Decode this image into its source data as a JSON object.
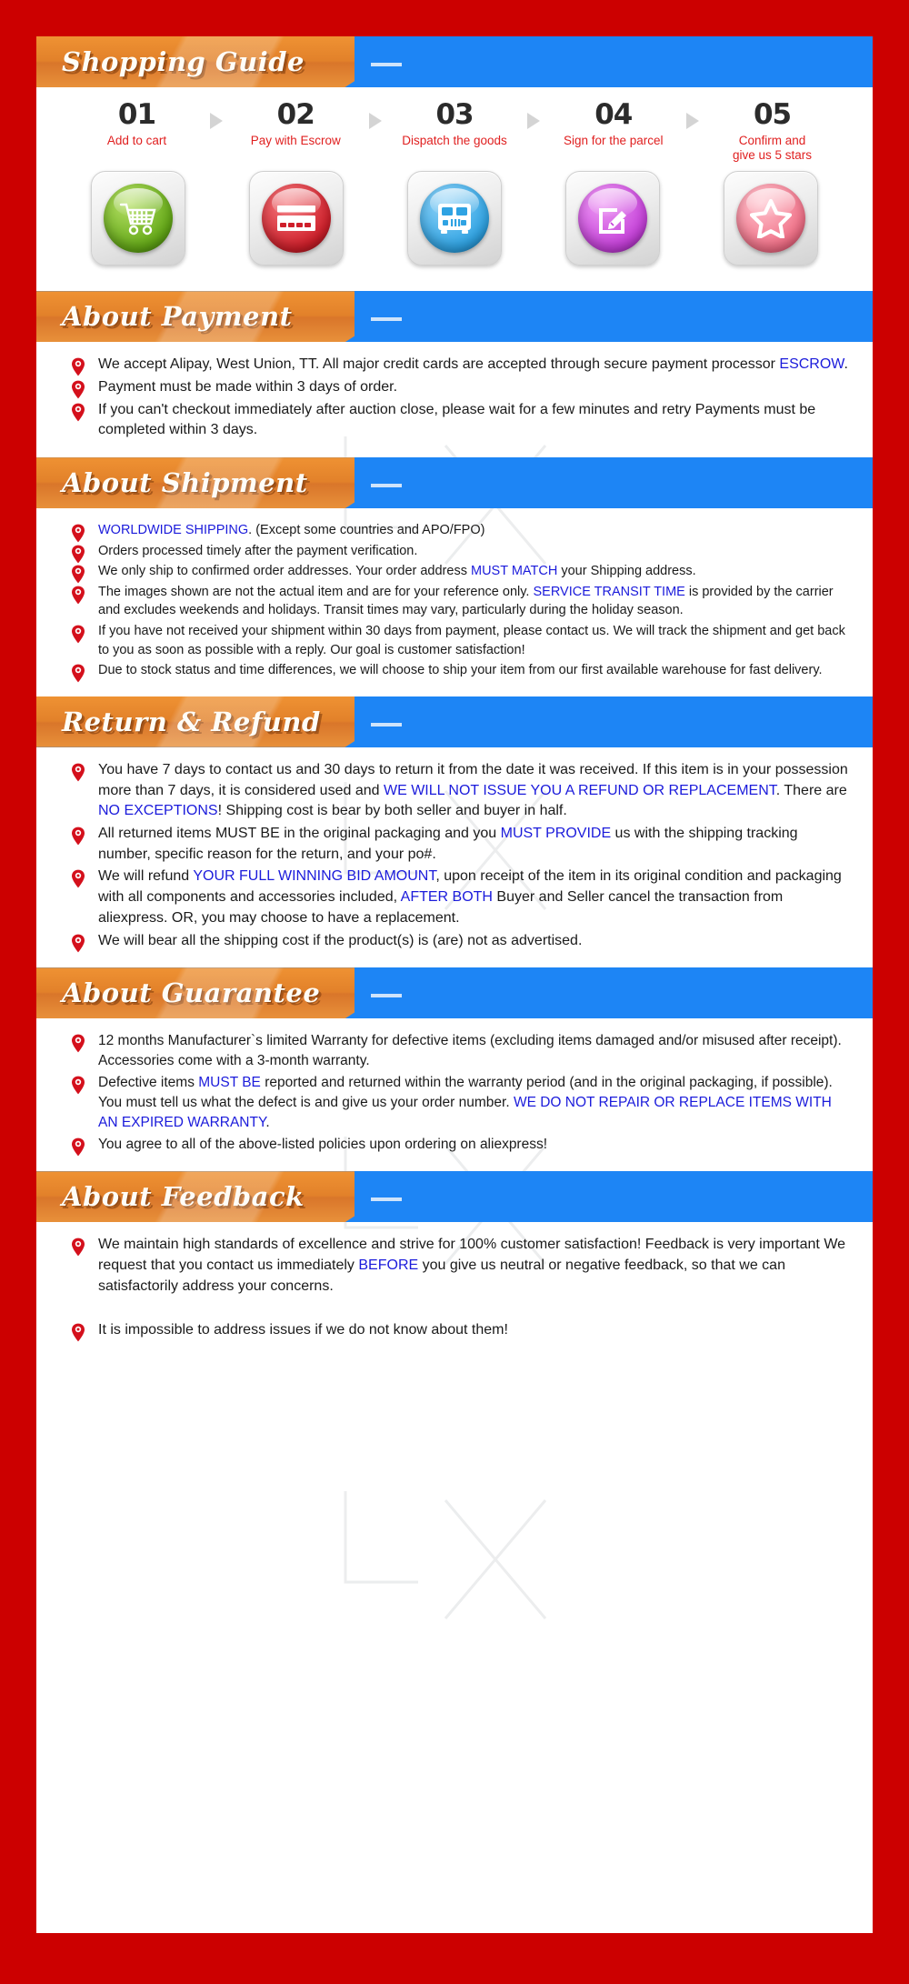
{
  "theme": {
    "page_background": "#cc0000",
    "banner_orange": "#e2812a",
    "banner_blue": "#1d85f5",
    "highlight_blue": "#1b1bdb",
    "step_label_red": "#e02020"
  },
  "guide": {
    "title": "Shopping Guide",
    "steps": [
      {
        "num": "01",
        "label": "Add to cart",
        "icon": "shopping-cart-icon",
        "color": "#63a816"
      },
      {
        "num": "02",
        "label": "Pay with Escrow",
        "icon": "credit-card-icon",
        "color": "#cf1f2a"
      },
      {
        "num": "03",
        "label": "Dispatch the goods",
        "icon": "delivery-truck-icon",
        "color": "#2fa3e3"
      },
      {
        "num": "04",
        "label": "Sign for the parcel",
        "icon": "sign-document-icon",
        "color": "#c43fd8"
      },
      {
        "num": "05",
        "label": "Confirm and\ngive us 5 stars",
        "icon": "star-rating-icon",
        "color": "#f06f86"
      }
    ]
  },
  "sections": [
    {
      "title": "About Payment",
      "items": [
        [
          {
            "t": "We accept Alipay, West Union, TT. All major credit cards are accepted through secure payment processor "
          },
          {
            "t": "ESCROW",
            "hl": true
          },
          {
            "t": "."
          }
        ],
        [
          {
            "t": "Payment must be made within 3 days of order."
          }
        ],
        [
          {
            "t": "If you can't checkout immediately after auction close, please wait for a few minutes and retry Payments must be completed within 3 days."
          }
        ]
      ]
    },
    {
      "title": "About Shipment",
      "items": [
        [
          {
            "t": "WORLDWIDE SHIPPING",
            "hl": true
          },
          {
            "t": ". (Except some countries and APO/FPO)"
          }
        ],
        [
          {
            "t": "Orders processed timely after the payment verification."
          }
        ],
        [
          {
            "t": "We only ship to confirmed order addresses. Your order address "
          },
          {
            "t": "MUST MATCH",
            "hl": true
          },
          {
            "t": " your Shipping address."
          }
        ],
        [
          {
            "t": "The images shown are not the actual item and are for your reference only. "
          },
          {
            "t": "SERVICE TRANSIT TIME",
            "hl": true
          },
          {
            "t": " is provided by the carrier and excludes weekends and holidays. Transit times may vary, particularly during the holiday season."
          }
        ],
        [
          {
            "t": "If you have not received your shipment within 30 days from payment, please contact us. We will track the shipment and get back to you as soon as possible with a reply. Our goal is customer satisfaction!"
          }
        ],
        [
          {
            "t": "Due to stock status and time differences, we will choose to ship your item from our first available warehouse for fast delivery."
          }
        ]
      ]
    },
    {
      "title": "Return & Refund",
      "items": [
        [
          {
            "t": "You have 7 days to contact us and 30 days to return it from the date it was received. If this item is in your possession more than 7 days, it is considered used and "
          },
          {
            "t": "WE WILL NOT ISSUE YOU A REFUND OR REPLACEMENT",
            "hl": true
          },
          {
            "t": ". There are "
          },
          {
            "t": "NO EXCEPTIONS",
            "hl": true
          },
          {
            "t": "! Shipping cost is bear by both seller and buyer in half."
          }
        ],
        [
          {
            "t": "All returned items MUST BE in the original packaging and you "
          },
          {
            "t": "MUST PROVIDE",
            "hl": true
          },
          {
            "t": " us with the shipping tracking number, specific reason for the return, and your po#."
          }
        ],
        [
          {
            "t": "We will refund "
          },
          {
            "t": "YOUR FULL WINNING BID AMOUNT",
            "hl": true
          },
          {
            "t": ", upon receipt of the item in its original condition and packaging with all components and accessories included, "
          },
          {
            "t": "AFTER BOTH",
            "hl": true
          },
          {
            "t": " Buyer and Seller cancel the transaction from aliexpress. OR, you may choose to have a replacement."
          }
        ],
        [
          {
            "t": "We will bear all the shipping cost if the product(s) is (are) not as advertised."
          }
        ]
      ]
    },
    {
      "title": "About Guarantee",
      "items": [
        [
          {
            "t": "12 months Manufacturer`s limited Warranty for defective items (excluding items damaged and/or misused after receipt). Accessories come with a 3-month warranty."
          }
        ],
        [
          {
            "t": "Defective items "
          },
          {
            "t": "MUST BE",
            "hl": true
          },
          {
            "t": " reported and returned within the warranty period (and in the original packaging, if possible). You must tell us what the defect is and give us your order number. "
          },
          {
            "t": "WE DO NOT REPAIR OR REPLACE ITEMS WITH AN EXPIRED WARRANTY",
            "hl": true
          },
          {
            "t": "."
          }
        ],
        [
          {
            "t": "You agree to all of the above-listed policies upon ordering on aliexpress!"
          }
        ]
      ]
    },
    {
      "title": "About Feedback",
      "items": [
        [
          {
            "t": "We maintain high standards of excellence and strive for 100% customer satisfaction! Feedback is very important We request that you contact us immediately "
          },
          {
            "t": "BEFORE",
            "hl": true
          },
          {
            "t": " you give us neutral or negative feedback, so that we can satisfactorily address your concerns."
          }
        ],
        [
          {
            "t": "It is impossible to address issues if we do not know about them!"
          }
        ]
      ]
    }
  ]
}
